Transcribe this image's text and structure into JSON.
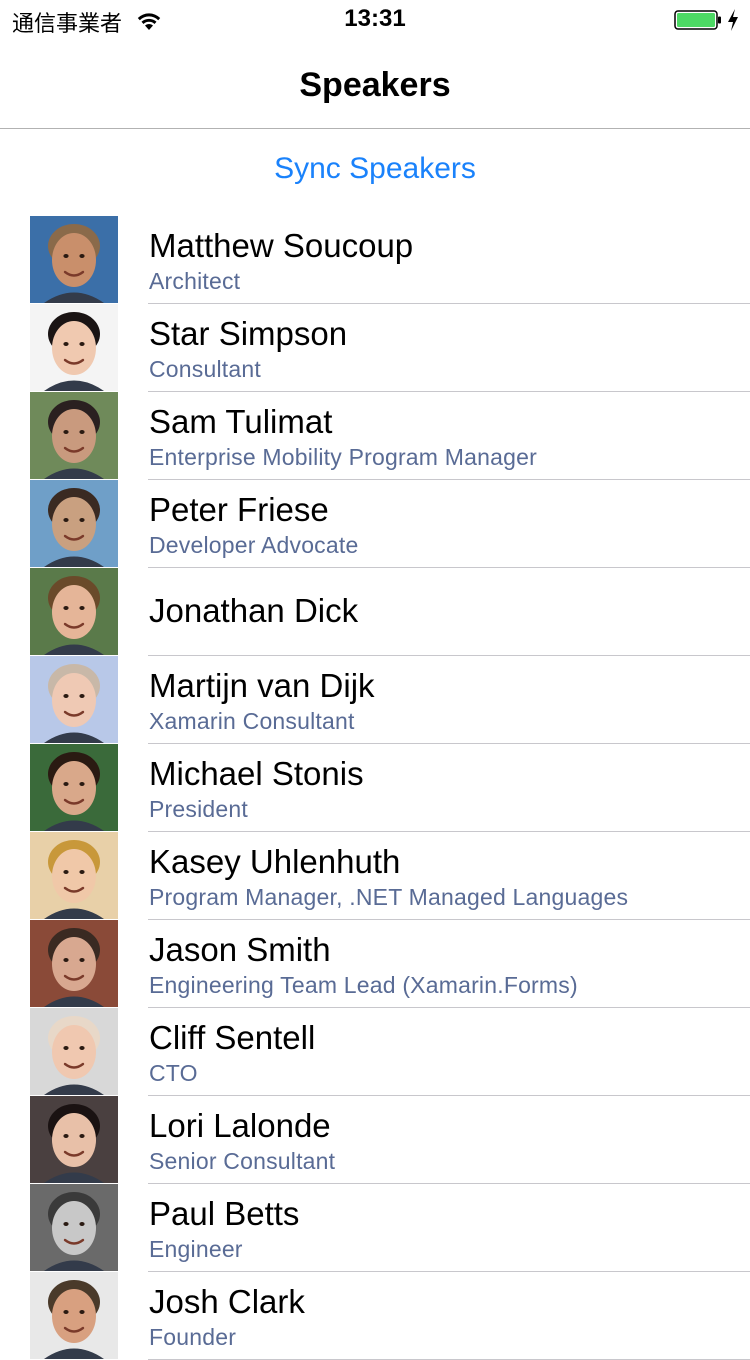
{
  "status_bar": {
    "carrier": "通信事業者",
    "time": "13:31",
    "wifi_icon": "wifi-icon",
    "battery_icon": "battery-icon",
    "battery_color": "#4cd964"
  },
  "nav": {
    "title": "Speakers"
  },
  "sync_label": "Sync Speakers",
  "colors": {
    "accent": "#1a82fb",
    "subtitle": "#596b95"
  },
  "speakers": [
    {
      "name": "Matthew Soucoup",
      "title": "Architect",
      "skin": "#c98f6b",
      "hair": "#8a6a4a",
      "bg": "#3b6fa8"
    },
    {
      "name": "Star Simpson",
      "title": "Consultant",
      "skin": "#f0c9b0",
      "hair": "#1a1414",
      "bg": "#f4f4f4"
    },
    {
      "name": "Sam Tulimat",
      "title": "Enterprise Mobility Program Manager",
      "skin": "#c99a7e",
      "hair": "#2a2020",
      "bg": "#6f8a5a"
    },
    {
      "name": "Peter Friese",
      "title": "Developer Advocate",
      "skin": "#c9a080",
      "hair": "#3a2a22",
      "bg": "#6f9fc8"
    },
    {
      "name": "Jonathan Dick",
      "title": "",
      "skin": "#e5b598",
      "hair": "#6a4a2a",
      "bg": "#5a7a4a"
    },
    {
      "name": "Martijn van Dijk",
      "title": "Xamarin Consultant",
      "skin": "#efc9b4",
      "hair": "#c8b8a8",
      "bg": "#b8c8e8"
    },
    {
      "name": "Michael Stonis",
      "title": "President",
      "skin": "#d9a88a",
      "hair": "#2a1a12",
      "bg": "#3a6a3a"
    },
    {
      "name": "Kasey Uhlenhuth",
      "title": "Program Manager, .NET Managed Languages",
      "skin": "#f0c8a8",
      "hair": "#c8983a",
      "bg": "#e8d0a8"
    },
    {
      "name": "Jason Smith",
      "title": "Engineering Team Lead (Xamarin.Forms)",
      "skin": "#d8a890",
      "hair": "#3a2a22",
      "bg": "#8a4a38"
    },
    {
      "name": "Cliff Sentell",
      "title": "CTO",
      "skin": "#f0c8b0",
      "hair": "#e8d8c8",
      "bg": "#d8d8d8"
    },
    {
      "name": "Lori Lalonde",
      "title": "Senior Consultant",
      "skin": "#e8c0a8",
      "hair": "#1a1212",
      "bg": "#4a4040"
    },
    {
      "name": "Paul Betts",
      "title": "Engineer",
      "skin": "#c8c8c8",
      "hair": "#3a3a3a",
      "bg": "#6a6a6a"
    },
    {
      "name": "Josh Clark",
      "title": "Founder",
      "skin": "#d8a080",
      "hair": "#4a3a2a",
      "bg": "#e8e8e8"
    }
  ]
}
